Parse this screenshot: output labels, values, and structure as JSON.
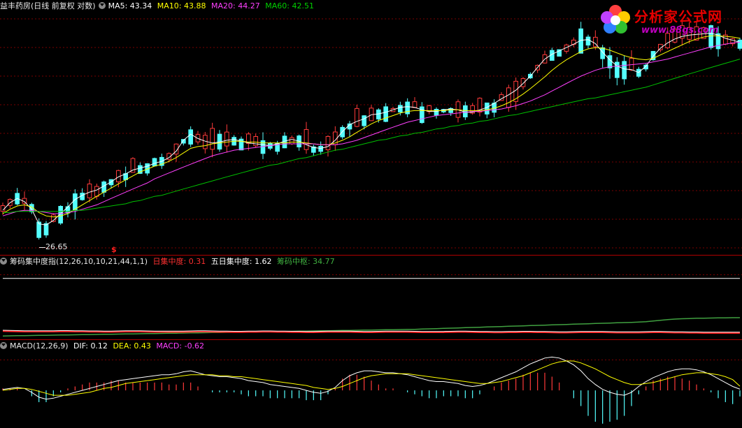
{
  "header": {
    "stock_title": "益丰药房(日线 前复权 对数)",
    "ma5": "MA5: 43.34",
    "ma10": "MA10: 43.88",
    "ma20": "MA20: 44.27",
    "ma60": "MA60: 42.51",
    "low_marker": "26.65",
    "signal_marker": "$"
  },
  "chip_panel": {
    "name": "筹码集中度指(12,26,10,10,21,44,1,1)",
    "label_daily": "日集中度: ",
    "value_daily": "0.31",
    "label_five_day": "五日集中度: ",
    "value_five_day": "1.62",
    "label_center": "筹码中枢: ",
    "value_center": "34.77"
  },
  "macd_panel": {
    "name": "MACD(12,26,9)",
    "label_dif": "DIF: ",
    "value_dif": "0.12",
    "label_dea": "DEA: ",
    "value_dea": "0.43",
    "label_macd": "MACD: ",
    "value_macd": "-0.62"
  },
  "logo": {
    "text": "分析家公式网",
    "url": "www.88gs.com"
  },
  "colors": {
    "up": "#ff3a3a",
    "down": "#54ffff",
    "ma5": "#ffffff",
    "ma10": "#ffff00",
    "ma20": "#ff40ff",
    "ma60": "#00c000",
    "grid": "#7a0000",
    "separator": "#b00000"
  },
  "chart_data": [
    {
      "type": "candlestick",
      "title": "益丰药房(日线 前复权 对数)",
      "ylim": [
        26,
        54
      ],
      "y_scale": "log",
      "grid": true,
      "series": [
        {
          "name": "MA5",
          "values": [
            29.5,
            30.2,
            30.6,
            30.3,
            29.6,
            28.3,
            28.2,
            28.6,
            29.2,
            29.8,
            30.5,
            30.9,
            31.2,
            31.4,
            31.8,
            32.2,
            32.7,
            33.0,
            33.4,
            33.6,
            33.8,
            34.1,
            34.3,
            34.7,
            35.4,
            36.6,
            37.3,
            36.8,
            36.5,
            36.3,
            36.4,
            36.6,
            36.7,
            36.5,
            36.3,
            36.2,
            36.1,
            36.0,
            36.2,
            36.5,
            36.7,
            36.5,
            36.1,
            35.8,
            35.7,
            35.9,
            36.6,
            37.6,
            38.4,
            38.8,
            39.1,
            39.6,
            39.7,
            39.9,
            40.2,
            40.5,
            40.6,
            40.5,
            40.2,
            40.0,
            40.0,
            40.2,
            40.3,
            40.2,
            39.9,
            39.9,
            40.2,
            40.5,
            41.0,
            41.6,
            42.1,
            42.7,
            43.6,
            44.6,
            45.8,
            47.0,
            47.7,
            48.2,
            48.7,
            49.2,
            49.8,
            49.9,
            49.3,
            48.0,
            46.9,
            46.0,
            45.6,
            45.5,
            45.1,
            46.0,
            47.4,
            48.6,
            49.4,
            50.0,
            50.4,
            50.6,
            50.7,
            50.8,
            50.9,
            50.6,
            50.1,
            49.8,
            49.5
          ]
        },
        {
          "name": "MA10",
          "values": [
            29.2,
            29.6,
            29.9,
            30.0,
            29.8,
            29.3,
            29.0,
            28.9,
            29.0,
            29.2,
            29.6,
            30.0,
            30.4,
            30.8,
            31.2,
            31.6,
            32.0,
            32.4,
            32.8,
            33.2,
            33.5,
            33.8,
            34.0,
            34.3,
            34.7,
            35.2,
            35.7,
            35.9,
            36.0,
            36.2,
            36.3,
            36.4,
            36.5,
            36.5,
            36.4,
            36.4,
            36.3,
            36.3,
            36.3,
            36.3,
            36.4,
            36.4,
            36.3,
            36.2,
            36.1,
            36.1,
            36.3,
            36.6,
            37.0,
            37.5,
            38.0,
            38.5,
            38.9,
            39.2,
            39.5,
            39.8,
            40.0,
            40.1,
            40.1,
            40.1,
            40.1,
            40.1,
            40.2,
            40.2,
            40.1,
            40.1,
            40.1,
            40.2,
            40.4,
            40.7,
            41.1,
            41.6,
            42.2,
            42.9,
            43.7,
            44.5,
            45.4,
            46.2,
            46.9,
            47.5,
            48.1,
            48.5,
            48.7,
            48.6,
            48.3,
            47.9,
            47.5,
            47.2,
            47.0,
            46.9,
            47.1,
            47.6,
            48.1,
            48.6,
            49.1,
            49.6,
            50.0,
            50.3,
            50.5,
            50.5,
            50.4,
            50.3,
            50.1
          ]
        },
        {
          "name": "MA20",
          "values": [
            29.0,
            29.2,
            29.4,
            29.5,
            29.5,
            29.4,
            29.3,
            29.2,
            29.2,
            29.3,
            29.4,
            29.6,
            29.8,
            30.0,
            30.3,
            30.6,
            30.9,
            31.2,
            31.5,
            31.8,
            32.1,
            32.5,
            32.8,
            33.1,
            33.4,
            33.7,
            34.0,
            34.3,
            34.6,
            34.9,
            35.1,
            35.3,
            35.5,
            35.6,
            35.7,
            35.8,
            35.9,
            36.0,
            36.1,
            36.2,
            36.2,
            36.2,
            36.2,
            36.2,
            36.1,
            36.1,
            36.1,
            36.2,
            36.4,
            36.6,
            36.9,
            37.2,
            37.5,
            37.8,
            38.1,
            38.4,
            38.7,
            38.9,
            39.1,
            39.3,
            39.5,
            39.6,
            39.7,
            39.8,
            39.9,
            40.0,
            40.0,
            40.1,
            40.2,
            40.3,
            40.5,
            40.7,
            41.0,
            41.3,
            41.7,
            42.1,
            42.6,
            43.1,
            43.6,
            44.1,
            44.6,
            45.0,
            45.4,
            45.7,
            45.9,
            46.0,
            46.1,
            46.2,
            46.3,
            46.4,
            46.6,
            46.8,
            47.0,
            47.3,
            47.6,
            47.9,
            48.2,
            48.5,
            48.8,
            49.0,
            49.2,
            49.4,
            49.5
          ]
        },
        {
          "name": "MA60",
          "values": [
            29.3,
            29.3,
            29.4,
            29.4,
            29.4,
            29.4,
            29.4,
            29.4,
            29.4,
            29.4,
            29.5,
            29.5,
            29.6,
            29.7,
            29.8,
            29.9,
            30.0,
            30.1,
            30.3,
            30.4,
            30.6,
            30.8,
            30.9,
            31.1,
            31.3,
            31.5,
            31.7,
            31.9,
            32.1,
            32.3,
            32.5,
            32.7,
            32.9,
            33.1,
            33.3,
            33.5,
            33.7,
            33.9,
            34.0,
            34.2,
            34.4,
            34.6,
            34.7,
            34.9,
            35.1,
            35.3,
            35.5,
            35.6,
            35.8,
            36.0,
            36.2,
            36.4,
            36.6,
            36.7,
            36.9,
            37.1,
            37.2,
            37.4,
            37.5,
            37.7,
            37.9,
            38.0,
            38.2,
            38.3,
            38.5,
            38.6,
            38.8,
            38.9,
            39.1,
            39.3,
            39.5,
            39.6,
            39.8,
            40.0,
            40.2,
            40.4,
            40.6,
            40.8,
            41.0,
            41.2,
            41.4,
            41.6,
            41.7,
            41.9,
            42.1,
            42.3,
            42.5,
            42.7,
            42.9,
            43.1,
            43.4,
            43.7,
            44.0,
            44.3,
            44.6,
            44.9,
            45.2,
            45.5,
            45.8,
            46.1,
            46.4,
            46.7,
            47.0
          ]
        }
      ]
    },
    {
      "type": "line",
      "title": "筹码集中度指(12,26,10,10,21,44,1,1)",
      "ylim": [
        0,
        6
      ],
      "series": [
        {
          "name": "日集中度",
          "values": [
            0.48,
            0.47,
            0.45,
            0.44,
            0.43,
            0.43,
            0.43,
            0.44,
            0.45,
            0.45,
            0.44,
            0.43,
            0.42,
            0.42,
            0.41,
            0.41,
            0.42,
            0.43,
            0.44,
            0.43,
            0.42,
            0.41,
            0.4,
            0.4,
            0.4,
            0.41,
            0.42,
            0.43,
            0.43,
            0.42,
            0.41,
            0.4,
            0.39,
            0.39,
            0.4,
            0.41,
            0.42,
            0.42,
            0.41,
            0.4,
            0.39,
            0.39,
            0.38,
            0.38,
            0.39,
            0.4,
            0.41,
            0.41,
            0.4,
            0.39,
            0.38,
            0.38,
            0.39,
            0.4,
            0.41,
            0.41,
            0.4,
            0.39,
            0.38,
            0.37,
            0.37,
            0.38,
            0.39,
            0.4,
            0.4,
            0.39,
            0.38,
            0.37,
            0.36,
            0.36,
            0.37,
            0.38,
            0.39,
            0.39,
            0.38,
            0.37,
            0.36,
            0.35,
            0.35,
            0.36,
            0.37,
            0.38,
            0.38,
            0.37,
            0.36,
            0.35,
            0.34,
            0.34,
            0.35,
            0.36,
            0.37,
            0.37,
            0.36,
            0.35,
            0.34,
            0.33,
            0.33,
            0.32,
            0.32,
            0.31,
            0.31,
            0.31,
            0.31
          ]
        },
        {
          "name": "五日集中度",
          "values": [
            0.05,
            0.06,
            0.07,
            0.08,
            0.09,
            0.1,
            0.11,
            0.12,
            0.13,
            0.14,
            0.15,
            0.16,
            0.17,
            0.18,
            0.19,
            0.2,
            0.21,
            0.22,
            0.23,
            0.24,
            0.25,
            0.26,
            0.27,
            0.28,
            0.29,
            0.3,
            0.31,
            0.32,
            0.33,
            0.34,
            0.35,
            0.36,
            0.37,
            0.38,
            0.39,
            0.4,
            0.41,
            0.42,
            0.43,
            0.44,
            0.45,
            0.46,
            0.47,
            0.48,
            0.49,
            0.5,
            0.51,
            0.52,
            0.53,
            0.54,
            0.55,
            0.56,
            0.57,
            0.58,
            0.59,
            0.6,
            0.61,
            0.62,
            0.64,
            0.66,
            0.68,
            0.7,
            0.72,
            0.74,
            0.76,
            0.78,
            0.8,
            0.82,
            0.84,
            0.86,
            0.88,
            0.9,
            0.92,
            0.94,
            0.96,
            0.98,
            1.0,
            1.02,
            1.04,
            1.06,
            1.08,
            1.1,
            1.12,
            1.14,
            1.16,
            1.18,
            1.2,
            1.22,
            1.24,
            1.28,
            1.34,
            1.4,
            1.46,
            1.5,
            1.53,
            1.55,
            1.57,
            1.58,
            1.59,
            1.6,
            1.61,
            1.62,
            1.62
          ]
        },
        {
          "name": "筹码中枢",
          "values": [
            5.0,
            5.0,
            5.0,
            5.0,
            5.0,
            5.0,
            5.0,
            5.0,
            5.0,
            5.0,
            5.0,
            5.0,
            5.0,
            5.0,
            5.0,
            5.0,
            5.0,
            5.0,
            5.0,
            5.0,
            5.0,
            5.0,
            5.0,
            5.0,
            5.0,
            5.0,
            5.0,
            5.0,
            5.0,
            5.0,
            5.0,
            5.0,
            5.0,
            5.0,
            5.0,
            5.0,
            5.0,
            5.0,
            5.0,
            5.0,
            5.0,
            5.0,
            5.0,
            5.0,
            5.0,
            5.0,
            5.0,
            5.0,
            5.0,
            5.0,
            5.0,
            5.0,
            5.0,
            5.0,
            5.0,
            5.0,
            5.0,
            5.0,
            5.0,
            5.0,
            5.0,
            5.0,
            5.0,
            5.0,
            5.0,
            5.0,
            5.0,
            5.0,
            5.0,
            5.0,
            5.0,
            5.0,
            5.0,
            5.0,
            5.0,
            5.0,
            5.0,
            5.0,
            5.0,
            5.0,
            5.0,
            5.0,
            5.0,
            5.0,
            5.0,
            5.0,
            5.0,
            5.0,
            5.0,
            5.0,
            5.0,
            5.0,
            5.0,
            5.0,
            5.0,
            5.0,
            5.0,
            5.0,
            5.0,
            5.0,
            5.0,
            5.0,
            5.0
          ]
        }
      ]
    },
    {
      "type": "macd",
      "title": "MACD(12,26,9)",
      "ylim": [
        -3.2,
        4.0
      ],
      "series": [
        {
          "name": "DIF",
          "values": [
            0.1,
            0.2,
            0.3,
            0.2,
            -0.2,
            -0.7,
            -0.9,
            -0.8,
            -0.6,
            -0.4,
            -0.2,
            0.0,
            0.2,
            0.4,
            0.6,
            0.8,
            1.0,
            1.1,
            1.2,
            1.3,
            1.4,
            1.5,
            1.6,
            1.6,
            1.7,
            1.9,
            2.0,
            1.8,
            1.6,
            1.5,
            1.4,
            1.4,
            1.3,
            1.2,
            1.0,
            0.9,
            0.8,
            0.6,
            0.5,
            0.4,
            0.3,
            0.2,
            0.0,
            -0.2,
            -0.3,
            -0.1,
            0.3,
            1.0,
            1.5,
            1.8,
            2.0,
            2.0,
            1.9,
            1.8,
            1.8,
            1.7,
            1.6,
            1.4,
            1.2,
            1.0,
            0.9,
            0.9,
            0.8,
            0.7,
            0.5,
            0.4,
            0.5,
            0.7,
            1.0,
            1.3,
            1.6,
            1.9,
            2.3,
            2.7,
            3.0,
            3.3,
            3.4,
            3.3,
            3.0,
            2.6,
            2.0,
            1.2,
            0.6,
            0.1,
            -0.2,
            -0.4,
            -0.5,
            -0.2,
            0.4,
            0.9,
            1.3,
            1.6,
            1.9,
            2.1,
            2.2,
            2.2,
            2.1,
            1.9,
            1.6,
            1.2,
            0.8,
            0.4,
            0.12
          ]
        },
        {
          "name": "DEA",
          "values": [
            0.0,
            0.1,
            0.2,
            0.2,
            0.1,
            -0.1,
            -0.3,
            -0.5,
            -0.5,
            -0.5,
            -0.4,
            -0.3,
            -0.2,
            0.0,
            0.2,
            0.3,
            0.5,
            0.7,
            0.8,
            0.9,
            1.0,
            1.1,
            1.2,
            1.3,
            1.4,
            1.5,
            1.6,
            1.6,
            1.6,
            1.6,
            1.5,
            1.5,
            1.4,
            1.4,
            1.3,
            1.2,
            1.1,
            1.0,
            0.9,
            0.8,
            0.7,
            0.6,
            0.5,
            0.3,
            0.2,
            0.1,
            0.2,
            0.4,
            0.7,
            1.0,
            1.3,
            1.5,
            1.6,
            1.7,
            1.7,
            1.7,
            1.7,
            1.6,
            1.5,
            1.4,
            1.3,
            1.2,
            1.1,
            1.0,
            0.9,
            0.8,
            0.7,
            0.7,
            0.8,
            0.9,
            1.1,
            1.3,
            1.5,
            1.8,
            2.1,
            2.4,
            2.7,
            2.9,
            3.0,
            3.0,
            2.8,
            2.5,
            2.2,
            1.8,
            1.4,
            1.1,
            0.8,
            0.6,
            0.6,
            0.7,
            0.8,
            1.0,
            1.2,
            1.4,
            1.6,
            1.7,
            1.8,
            1.8,
            1.7,
            1.6,
            1.4,
            1.1,
            0.43
          ]
        }
      ]
    }
  ]
}
